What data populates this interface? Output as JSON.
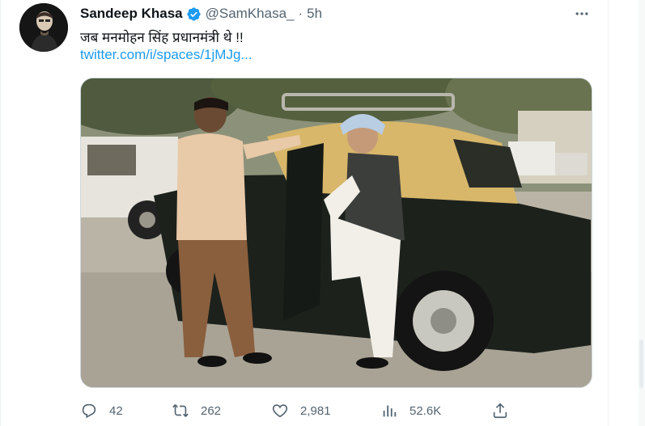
{
  "tweet": {
    "author_name": "Sandeep Khasa",
    "handle": "@SamKhasa_",
    "separator": "·",
    "time": "5h",
    "text": "जब मनमोहन सिंह प्रधानमंत्री थे !!",
    "link": "twitter.com/i/spaces/1jMJg..."
  },
  "metrics": {
    "replies": "42",
    "retweets": "262",
    "likes": "2,981",
    "views": "52.6K"
  },
  "icons": {
    "verified": "verified-badge-icon",
    "more": "more-options-icon",
    "reply": "reply-icon",
    "retweet": "retweet-icon",
    "like": "heart-icon",
    "views": "views-chart-icon",
    "share": "share-icon"
  },
  "colors": {
    "accent": "#1d9bf0",
    "secondary_text": "#536471",
    "primary_text": "#0f1419"
  }
}
